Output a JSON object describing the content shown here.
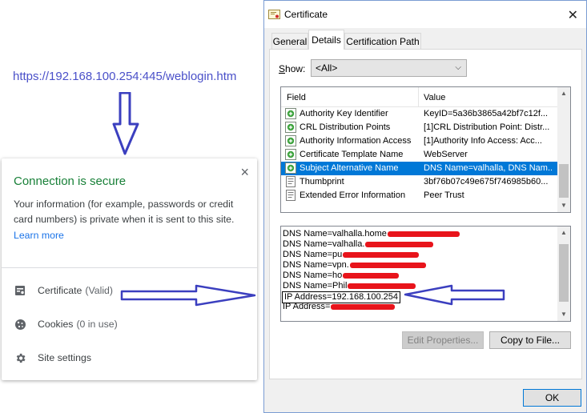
{
  "browser": {
    "url": "https://192.168.100.254:445/weblogin.htm"
  },
  "site_info_popup": {
    "close_glyph": "×",
    "title": "Connection is secure",
    "description": "Your information (for example, passwords or credit card numbers) is private when it is sent to this site.",
    "learn_more": "Learn more",
    "items": [
      {
        "label": "Certificate",
        "sublabel": "(Valid)",
        "icon": "certificate-icon"
      },
      {
        "label": "Cookies",
        "sublabel": "(0 in use)",
        "icon": "cookie-icon"
      },
      {
        "label": "Site settings",
        "sublabel": "",
        "icon": "gear-icon"
      }
    ],
    "colors": {
      "secure_green": "#188038",
      "link_blue": "#1a73e8"
    }
  },
  "certificate_dialog": {
    "title": "Certificate",
    "close_glyph": "✕",
    "tabs": [
      {
        "label": "General",
        "active": false
      },
      {
        "label": "Details",
        "active": true
      },
      {
        "label": "Certification Path",
        "active": false
      }
    ],
    "show": {
      "label": "Show:",
      "value": "<All>"
    },
    "fields_table": {
      "columns": [
        "Field",
        "Value"
      ],
      "rows": [
        {
          "field": "Authority Key Identifier",
          "value": "KeyID=5a36b3865a42bf7c12f...",
          "icon": "cert-extension-icon",
          "selected": false
        },
        {
          "field": "CRL Distribution Points",
          "value": "[1]CRL Distribution Point: Distr...",
          "icon": "cert-extension-icon",
          "selected": false
        },
        {
          "field": "Authority Information Access",
          "value": "[1]Authority Info Access: Acc...",
          "icon": "cert-extension-icon",
          "selected": false
        },
        {
          "field": "Certificate Template Name",
          "value": "WebServer",
          "icon": "cert-extension-icon",
          "selected": false
        },
        {
          "field": "Subject Alternative Name",
          "value": "DNS Name=valhalla, DNS Nam...",
          "icon": "cert-extension-icon",
          "selected": true
        },
        {
          "field": "Thumbprint",
          "value": "3bf76b07c49e675f746985b60...",
          "icon": "cert-property-icon",
          "selected": false
        },
        {
          "field": "Extended Error Information",
          "value": "Peer Trust",
          "icon": "cert-property-icon",
          "selected": false
        }
      ]
    },
    "value_lines": [
      {
        "text": "DNS Name=valhalla.home",
        "redacted": true,
        "highlighted": false
      },
      {
        "text": "DNS Name=valhalla.",
        "redacted": true,
        "highlighted": false
      },
      {
        "text": "DNS Name=pu",
        "redacted": true,
        "highlighted": false
      },
      {
        "text": "DNS Name=vpn.",
        "redacted": true,
        "highlighted": false
      },
      {
        "text": "DNS Name=ho",
        "redacted": true,
        "highlighted": false
      },
      {
        "text": "DNS Name=Phil",
        "redacted": true,
        "highlighted": false
      },
      {
        "text": "IP Address=192.168.100.254",
        "redacted": false,
        "highlighted": true
      },
      {
        "text": "IP Address=",
        "redacted": true,
        "highlighted": false
      }
    ],
    "buttons": {
      "edit_properties": "Edit Properties...",
      "copy_to_file": "Copy to File...",
      "ok": "OK"
    },
    "colors": {
      "selection": "#0078d7",
      "redaction": "#e8141b"
    }
  },
  "annotation_arrow_color": "#3b3fbf"
}
